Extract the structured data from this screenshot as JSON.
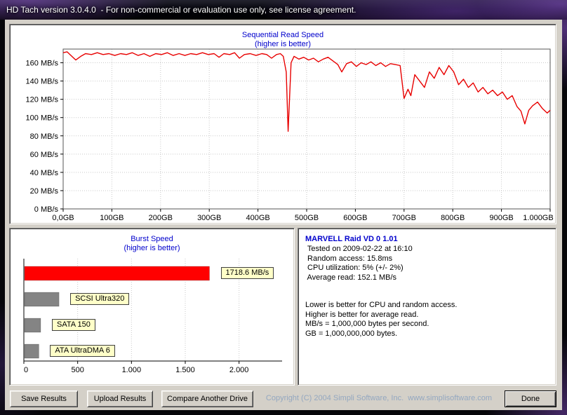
{
  "window": {
    "title": "HD Tach version 3.0.4.0  - For non-commercial or evaluation use only, see license agreement."
  },
  "chart_data": [
    {
      "type": "line",
      "title": "Sequential Read Speed",
      "subtitle": "(higher is better)",
      "xlim": [
        0,
        1000
      ],
      "ylim": [
        0,
        175
      ],
      "grid": true,
      "line_color": "#e80000",
      "y_ticks": [
        0,
        20,
        40,
        60,
        80,
        100,
        120,
        140,
        160
      ],
      "y_tick_suffix": " MB/s",
      "x_ticks": [
        0,
        100,
        200,
        300,
        400,
        500,
        600,
        700,
        800,
        900,
        1000
      ],
      "x_tick_labels": [
        "0,0GB",
        "100GB",
        "200GB",
        "300GB",
        "400GB",
        "500GB",
        "600GB",
        "700GB",
        "800GB",
        "900GB",
        "1.000GB"
      ],
      "points": [
        [
          0,
          171
        ],
        [
          8,
          172
        ],
        [
          16,
          168
        ],
        [
          26,
          163
        ],
        [
          36,
          167
        ],
        [
          46,
          170
        ],
        [
          58,
          169
        ],
        [
          70,
          171
        ],
        [
          82,
          169
        ],
        [
          94,
          170
        ],
        [
          106,
          168
        ],
        [
          118,
          170
        ],
        [
          130,
          169
        ],
        [
          142,
          171
        ],
        [
          154,
          168
        ],
        [
          166,
          170
        ],
        [
          178,
          167
        ],
        [
          190,
          170
        ],
        [
          202,
          169
        ],
        [
          214,
          171
        ],
        [
          226,
          168
        ],
        [
          238,
          170
        ],
        [
          250,
          168
        ],
        [
          262,
          170
        ],
        [
          274,
          169
        ],
        [
          286,
          171
        ],
        [
          298,
          169
        ],
        [
          310,
          170
        ],
        [
          320,
          166
        ],
        [
          330,
          170
        ],
        [
          342,
          169
        ],
        [
          352,
          171
        ],
        [
          362,
          165
        ],
        [
          372,
          169
        ],
        [
          384,
          170
        ],
        [
          396,
          168
        ],
        [
          408,
          170
        ],
        [
          418,
          169
        ],
        [
          428,
          165
        ],
        [
          438,
          169
        ],
        [
          446,
          170
        ],
        [
          452,
          167
        ],
        [
          458,
          150
        ],
        [
          462,
          85
        ],
        [
          468,
          160
        ],
        [
          474,
          167
        ],
        [
          484,
          164
        ],
        [
          494,
          166
        ],
        [
          504,
          163
        ],
        [
          514,
          165
        ],
        [
          524,
          161
        ],
        [
          534,
          164
        ],
        [
          544,
          166
        ],
        [
          554,
          162
        ],
        [
          564,
          158
        ],
        [
          572,
          150
        ],
        [
          582,
          159
        ],
        [
          592,
          161
        ],
        [
          602,
          156
        ],
        [
          612,
          160
        ],
        [
          622,
          158
        ],
        [
          632,
          161
        ],
        [
          642,
          157
        ],
        [
          652,
          160
        ],
        [
          662,
          156
        ],
        [
          672,
          159
        ],
        [
          682,
          158
        ],
        [
          692,
          157
        ],
        [
          700,
          121
        ],
        [
          708,
          131
        ],
        [
          714,
          124
        ],
        [
          722,
          147
        ],
        [
          732,
          140
        ],
        [
          742,
          133
        ],
        [
          752,
          150
        ],
        [
          762,
          143
        ],
        [
          772,
          155
        ],
        [
          782,
          147
        ],
        [
          792,
          157
        ],
        [
          802,
          150
        ],
        [
          812,
          136
        ],
        [
          822,
          142
        ],
        [
          832,
          133
        ],
        [
          842,
          138
        ],
        [
          852,
          128
        ],
        [
          862,
          133
        ],
        [
          872,
          126
        ],
        [
          882,
          130
        ],
        [
          892,
          124
        ],
        [
          902,
          128
        ],
        [
          912,
          120
        ],
        [
          922,
          124
        ],
        [
          932,
          112
        ],
        [
          940,
          107
        ],
        [
          948,
          93
        ],
        [
          956,
          108
        ],
        [
          964,
          113
        ],
        [
          974,
          117
        ],
        [
          984,
          110
        ],
        [
          994,
          105
        ],
        [
          1000,
          108
        ]
      ]
    },
    {
      "type": "bar",
      "title": "Burst Speed",
      "subtitle": "(higher is better)",
      "orientation": "horizontal",
      "xlim": [
        0,
        2400
      ],
      "x_ticks": [
        0,
        500,
        1000,
        1500,
        2000
      ],
      "x_tick_labels": [
        "0",
        "500",
        "1.000",
        "1.500",
        "2.000"
      ],
      "label_box_bg": "#ffffc8",
      "bars": [
        {
          "label": "1718.6 MB/s",
          "value": 1718.6,
          "color": "#ff0000"
        },
        {
          "label": "SCSI Ultra320",
          "value": 320,
          "color": "#848484"
        },
        {
          "label": "SATA 150",
          "value": 150,
          "color": "#848484"
        },
        {
          "label": "ATA UltraDMA 6",
          "value": 133,
          "color": "#848484"
        }
      ]
    }
  ],
  "info": {
    "title": "MARVELL Raid VD 0 1.01",
    "lines": [
      " Tested on 2009-02-22 at 16:10",
      " Random access: 15.8ms",
      " CPU utilization: 5% (+/- 2%)",
      " Average read: 152.1 MB/s",
      "",
      "",
      "Lower is better for CPU and random access.",
      "Higher is better for average read.",
      "MB/s = 1,000,000 bytes per second.",
      "GB = 1,000,000,000 bytes."
    ]
  },
  "buttons": {
    "save": "Save Results",
    "upload": "Upload Results",
    "compare": "Compare Another Drive",
    "done": "Done"
  },
  "footer": {
    "copyright": "Copyright (C) 2004 Simpli Software, Inc.  www.simplisoftware.com"
  }
}
